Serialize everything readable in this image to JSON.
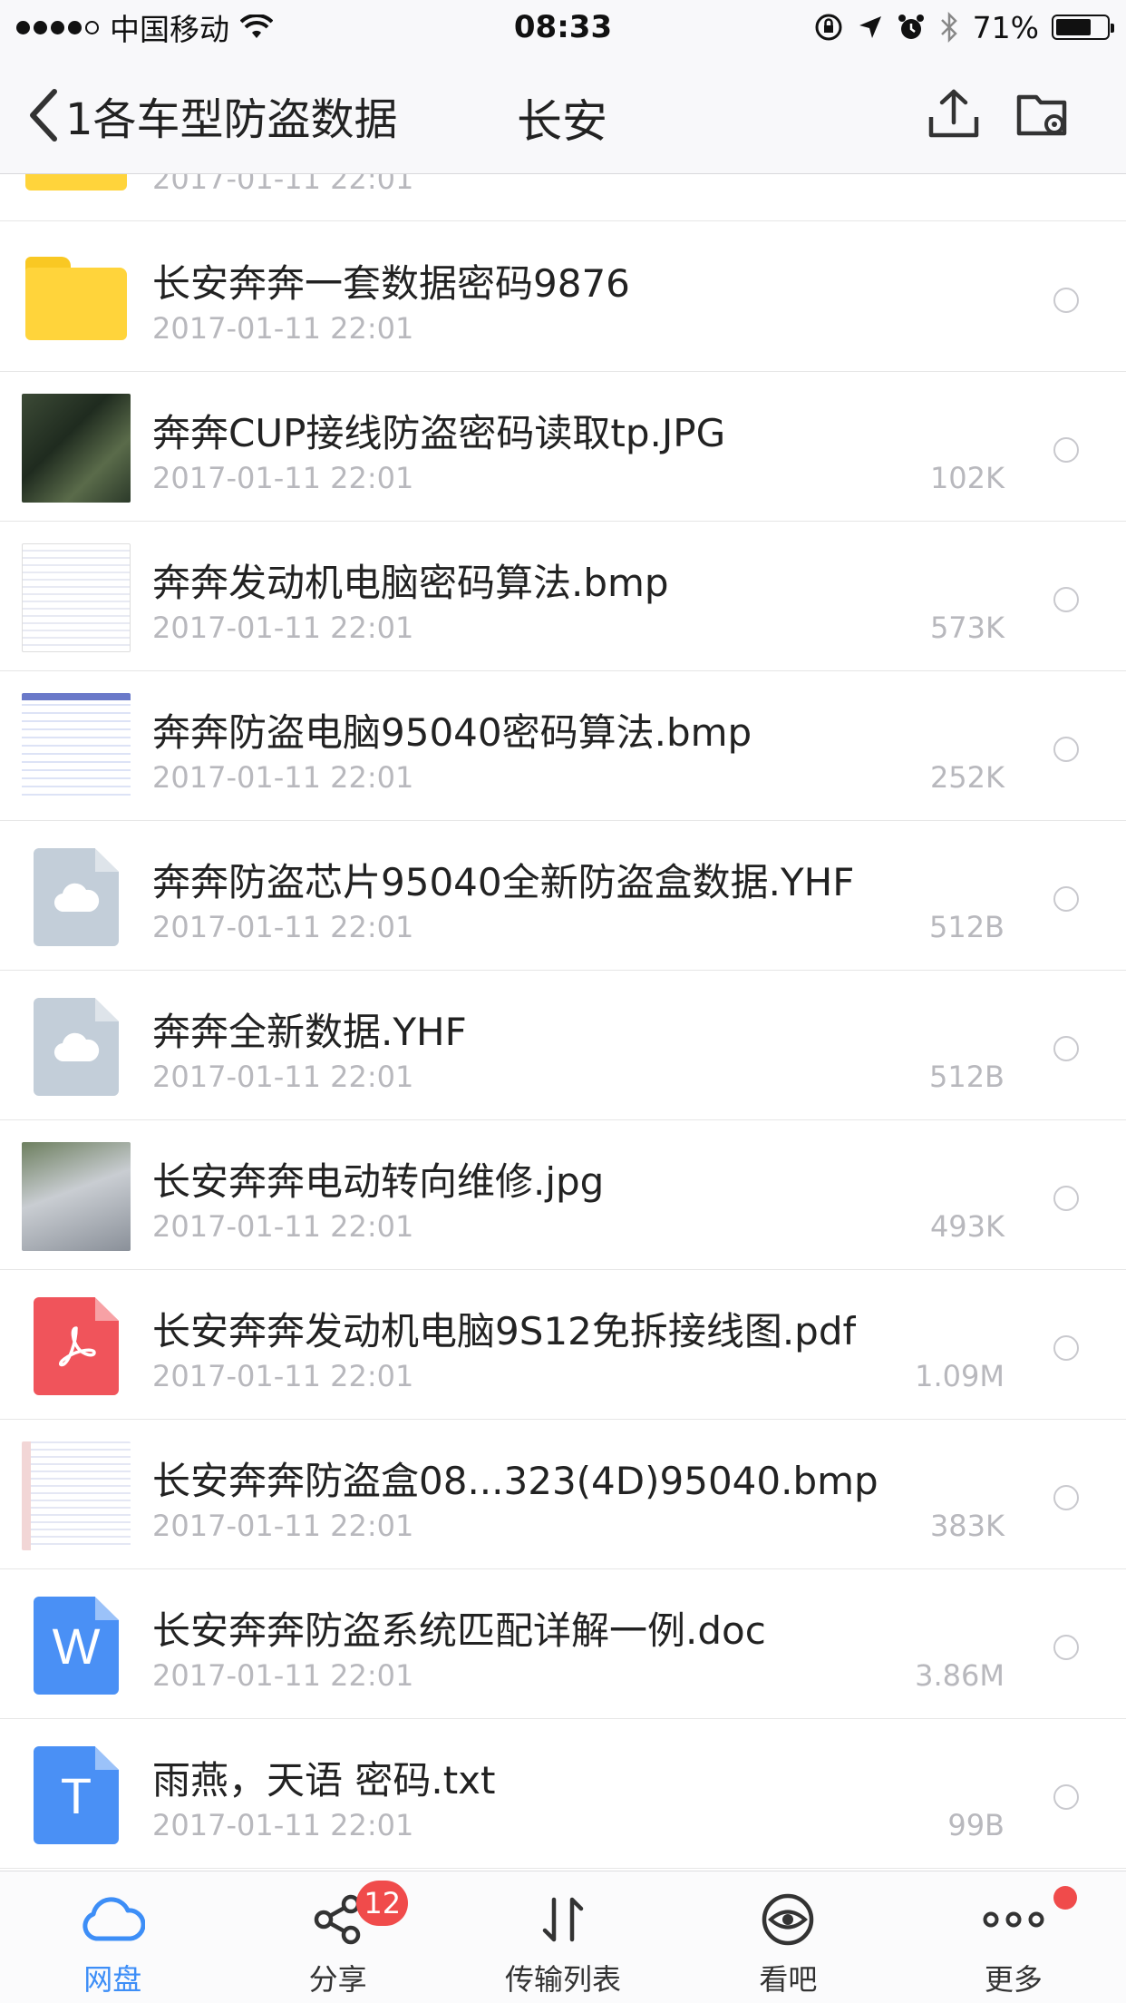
{
  "status_bar": {
    "carrier": "中国移动",
    "time": "08:33",
    "battery_percent": "71%",
    "battery_level": 0.71
  },
  "nav": {
    "back_label": "1各车型防盗数据",
    "title": "长安",
    "icons": [
      "upload-icon",
      "folder-settings-icon"
    ]
  },
  "partial_row": {
    "date": "2017-01-11 22:01"
  },
  "files": [
    {
      "name": "长安奔奔一套数据密码9876",
      "date": "2017-01-11 22:01",
      "size": "",
      "icon": "folder-icon"
    },
    {
      "name": "奔奔CUP接线防盗密码读取tp.JPG",
      "date": "2017-01-11 22:01",
      "size": "102K",
      "icon": "image-thumbnail"
    },
    {
      "name": "奔奔发动机电脑密码算法.bmp",
      "date": "2017-01-11 22:01",
      "size": "573K",
      "icon": "image-thumbnail"
    },
    {
      "name": "奔奔防盗电脑95040密码算法.bmp",
      "date": "2017-01-11 22:01",
      "size": "252K",
      "icon": "image-thumbnail"
    },
    {
      "name": "奔奔防盗芯片95040全新防盗盒数据.YHF",
      "date": "2017-01-11 22:01",
      "size": "512B",
      "icon": "cloud-file-icon"
    },
    {
      "name": "奔奔全新数据.YHF",
      "date": "2017-01-11 22:01",
      "size": "512B",
      "icon": "cloud-file-icon"
    },
    {
      "name": "长安奔奔电动转向维修.jpg",
      "date": "2017-01-11 22:01",
      "size": "493K",
      "icon": "image-thumbnail"
    },
    {
      "name": "长安奔奔发动机电脑9S12免拆接线图.pdf",
      "date": "2017-01-11 22:01",
      "size": "1.09M",
      "icon": "pdf-icon"
    },
    {
      "name": "长安奔奔防盗盒08...323(4D)95040.bmp",
      "date": "2017-01-11 22:01",
      "size": "383K",
      "icon": "image-thumbnail"
    },
    {
      "name": "长安奔奔防盗系统匹配详解一例.doc",
      "date": "2017-01-11 22:01",
      "size": "3.86M",
      "icon": "word-icon"
    },
    {
      "name": "雨燕，天语 密码.txt",
      "date": "2017-01-11 22:01",
      "size": "99B",
      "icon": "text-file-icon"
    }
  ],
  "icon_letters": {
    "word": "W",
    "text": "T"
  },
  "tabs": [
    {
      "label": "网盘",
      "icon": "cloud-icon",
      "active": true
    },
    {
      "label": "分享",
      "icon": "share-icon",
      "badge": "12"
    },
    {
      "label": "传输列表",
      "icon": "transfer-icon"
    },
    {
      "label": "看吧",
      "icon": "eye-icon"
    },
    {
      "label": "更多",
      "icon": "more-icon",
      "dot": true
    }
  ],
  "colors": {
    "accent": "#3d8ef7",
    "folder": "#ffd43b",
    "pdf": "#f0545b",
    "word": "#4a90f5",
    "badge": "#f04b4b",
    "meta_text": "#b8b8bd"
  }
}
